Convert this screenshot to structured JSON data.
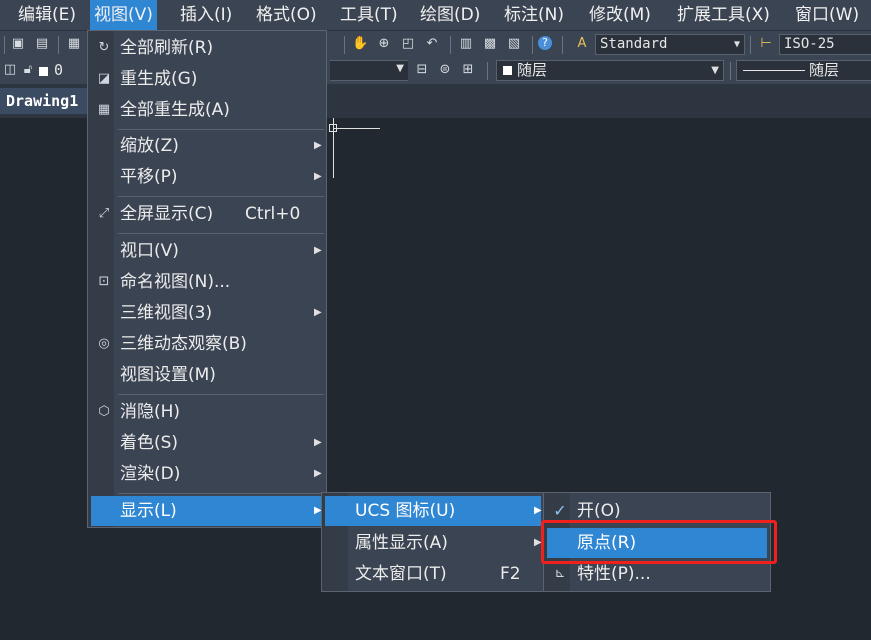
{
  "menubar": {
    "items": [
      "编辑(E)",
      "视图(V)",
      "插入(I)",
      "格式(O)",
      "工具(T)",
      "绘图(D)",
      "标注(N)",
      "修改(M)",
      "扩展工具(X)",
      "窗口(W)"
    ]
  },
  "toolbar": {
    "text_style": "Standard",
    "dim_style": "ISO-25",
    "layer": "0",
    "color": "随层",
    "linetype": "随层"
  },
  "tabs": {
    "drawing": "Drawing1"
  },
  "view_menu": {
    "items": [
      {
        "label": "全部刷新(R)",
        "icon": "refresh-icon"
      },
      {
        "label": "重生成(G)",
        "icon": "regen-icon"
      },
      {
        "label": "全部重生成(A)",
        "icon": "regen-all-icon"
      },
      {
        "label": "缩放(Z)"
      },
      {
        "label": "平移(P)"
      },
      {
        "label": "全屏显示(C)",
        "shortcut": "Ctrl+0",
        "icon": "fullscreen-icon"
      },
      {
        "label": "视口(V)"
      },
      {
        "label": "命名视图(N)...",
        "icon": "named-view-icon"
      },
      {
        "label": "三维视图(3)"
      },
      {
        "label": "三维动态观察(B)",
        "icon": "orbit-icon"
      },
      {
        "label": "视图设置(M)"
      },
      {
        "label": "消隐(H)",
        "icon": "hide-icon"
      },
      {
        "label": "着色(S)"
      },
      {
        "label": "渲染(D)"
      },
      {
        "label": "显示(L)"
      }
    ]
  },
  "display_menu": {
    "items": [
      {
        "label": "UCS 图标(U)"
      },
      {
        "label": "属性显示(A)"
      },
      {
        "label": "文本窗口(T)",
        "shortcut": "F2"
      }
    ]
  },
  "ucs_menu": {
    "items": [
      {
        "label": "开(O)",
        "checked": "✓"
      },
      {
        "label": "原点(R)"
      },
      {
        "label": "特性(P)..."
      }
    ]
  },
  "colors": {
    "accent": "#2f86d3",
    "highlight_box": "#f0201c",
    "canvas": "#212830"
  }
}
